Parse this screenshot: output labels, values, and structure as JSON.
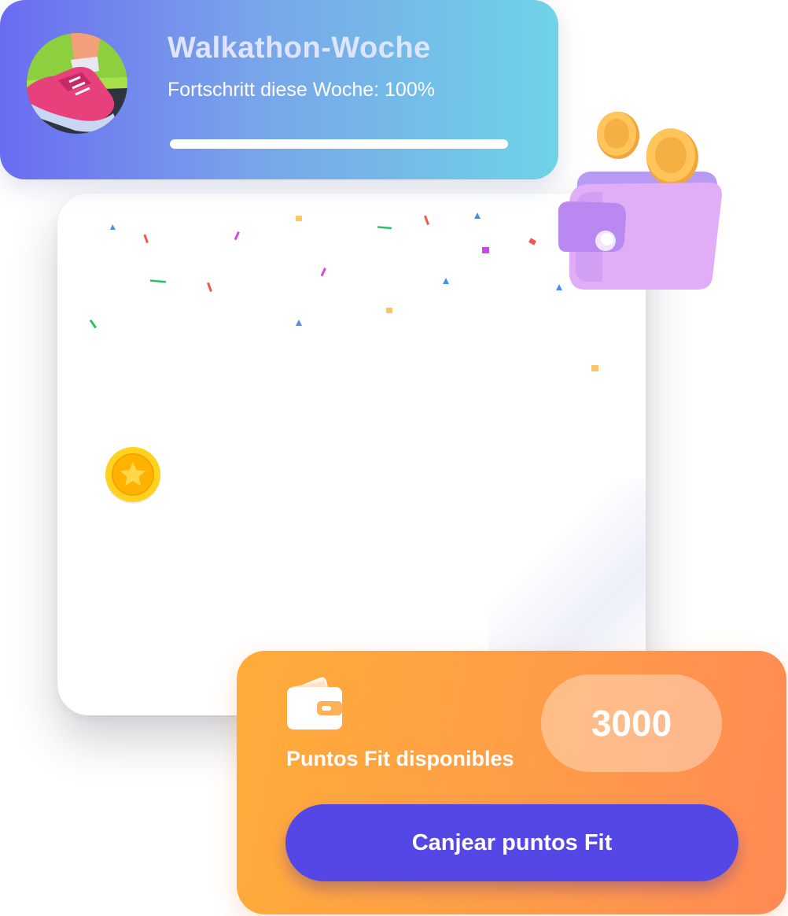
{
  "challenge": {
    "title": "Walkathon-Woche",
    "subtitle": "Fortschritt diese Woche: 100%",
    "progress_percent": 100,
    "avatar_icon": "sneaker-icon"
  },
  "wallet": {
    "label": "Puntos Fit disponibles",
    "points": "3000",
    "icon": "wallet-icon",
    "redeem_label": "Canjear puntos Fit"
  },
  "decorations": {
    "coin_icon": "star-coin-icon",
    "wallet_illustration": "wallet-coins-icon"
  },
  "colors": {
    "challenge_gradient_start": "#6a6cf0",
    "challenge_gradient_end": "#6fd3e6",
    "points_gradient_start": "#ffac3a",
    "points_gradient_end": "#ff8a55",
    "button": "#5547e6",
    "coin": "#ffc21a"
  }
}
